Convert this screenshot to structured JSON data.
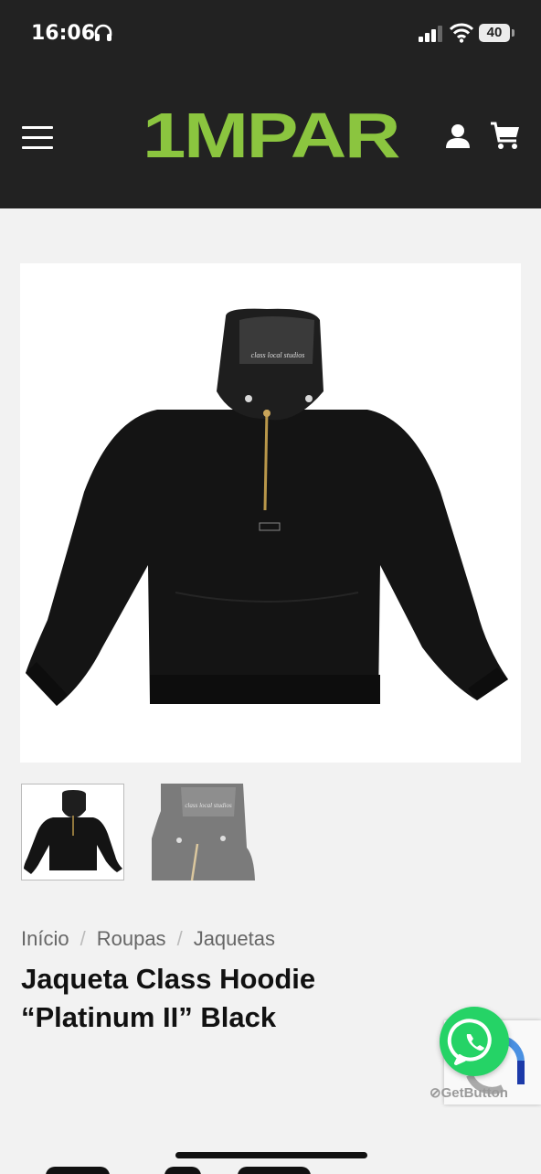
{
  "status_bar": {
    "time": "16:06",
    "battery": "40"
  },
  "header": {
    "logo_text": "1MPAR",
    "logo_color": "#8BC53F",
    "background": "#222222"
  },
  "icons": [
    "headphones-icon",
    "signal-icon",
    "wifi-icon",
    "battery-icon",
    "menu-icon",
    "user-icon",
    "cart-icon",
    "whatsapp-icon",
    "recaptcha-icon"
  ],
  "product": {
    "image_print": "class local studios",
    "breadcrumb": [
      {
        "label": "Início"
      },
      {
        "label": "Roupas"
      },
      {
        "label": "Jaquetas"
      }
    ],
    "breadcrumb_separator": "/",
    "title": "Jaqueta Class Hoodie “Platinum II” Black"
  },
  "widgets": {
    "getbutton_label": "GetButton"
  }
}
